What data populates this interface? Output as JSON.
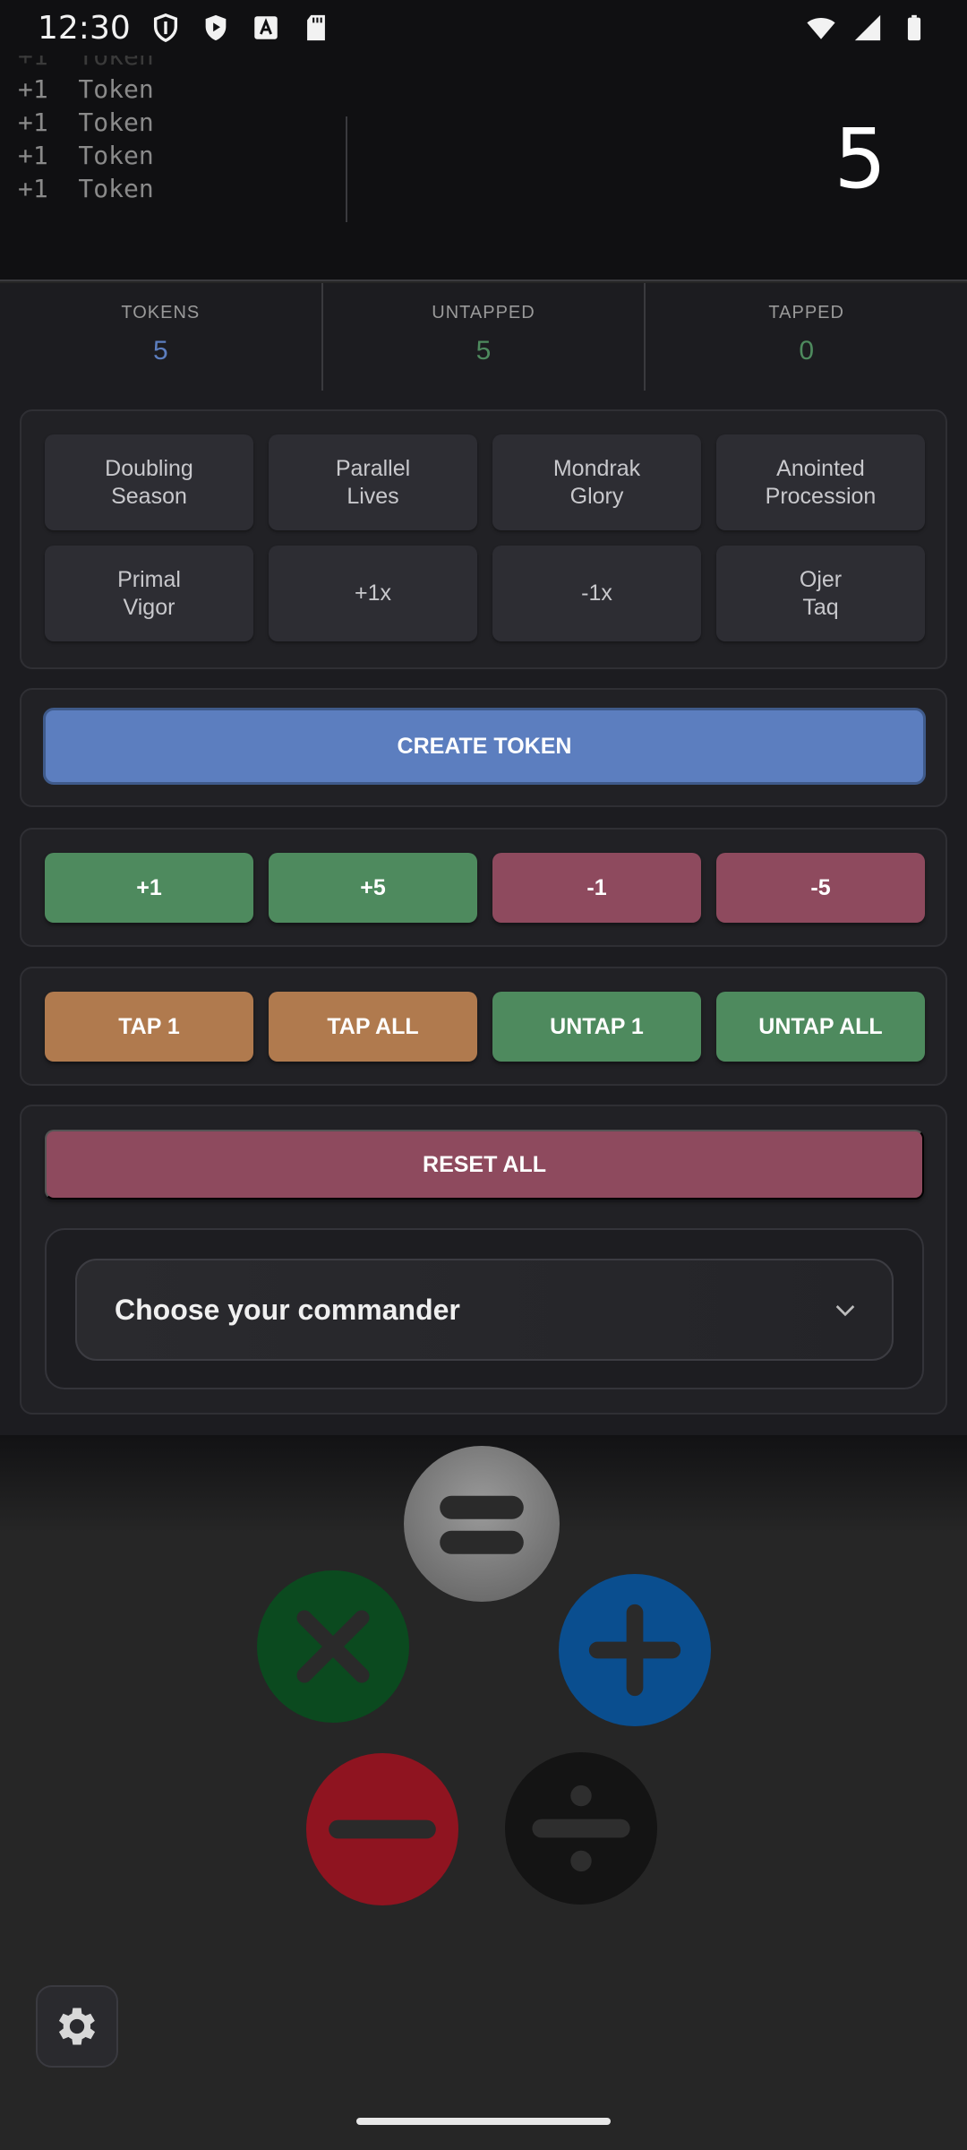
{
  "status_bar": {
    "time": "12:30",
    "left_icons": [
      "shield-icon",
      "play-protect-icon",
      "font-a-icon",
      "sd-card-icon"
    ],
    "right_icons": [
      "wifi-icon",
      "signal-icon",
      "battery-icon"
    ]
  },
  "history": {
    "faded_line": "+1  Token",
    "lines": [
      "+1  Token",
      "+1  Token",
      "+1  Token",
      "+1  Token"
    ]
  },
  "display": {
    "value": "5"
  },
  "stats": {
    "tokens": {
      "label": "TOKENS",
      "value": "5",
      "color": "#5c7ebf"
    },
    "untapped": {
      "label": "UNTAPPED",
      "value": "5",
      "color": "#4e8a5e"
    },
    "tapped": {
      "label": "TAPPED",
      "value": "0",
      "color": "#4e8a5e"
    }
  },
  "modifiers": [
    "Doubling\nSeason",
    "Parallel\nLives",
    "Mondrak\nGlory",
    "Anointed\nProcession",
    "Primal\nVigor",
    "+1x",
    "-1x",
    "Ojer\nTaq"
  ],
  "create": {
    "label": "CREATE TOKEN"
  },
  "count_buttons": {
    "plus1": "+1",
    "plus5": "+5",
    "minus1": "-1",
    "minus5": "-5"
  },
  "tap_buttons": {
    "tap1": "TAP 1",
    "tap_all": "TAP ALL",
    "untap1": "UNTAP 1",
    "untap_all": "UNTAP ALL"
  },
  "reset": {
    "label": "RESET ALL"
  },
  "commander": {
    "placeholder": "Choose your commander"
  },
  "calculator": {
    "equals": {
      "icon": "equals-icon",
      "color": "#7a7a7a"
    },
    "multiply": {
      "icon": "multiply-icon",
      "color": "#0b4a1f"
    },
    "add": {
      "icon": "plus-icon",
      "color": "#0a4e8f"
    },
    "subtract": {
      "icon": "minus-icon",
      "color": "#8f1420"
    },
    "divide": {
      "icon": "divide-icon",
      "color": "#141414"
    }
  },
  "settings": {
    "icon": "gear-icon"
  }
}
